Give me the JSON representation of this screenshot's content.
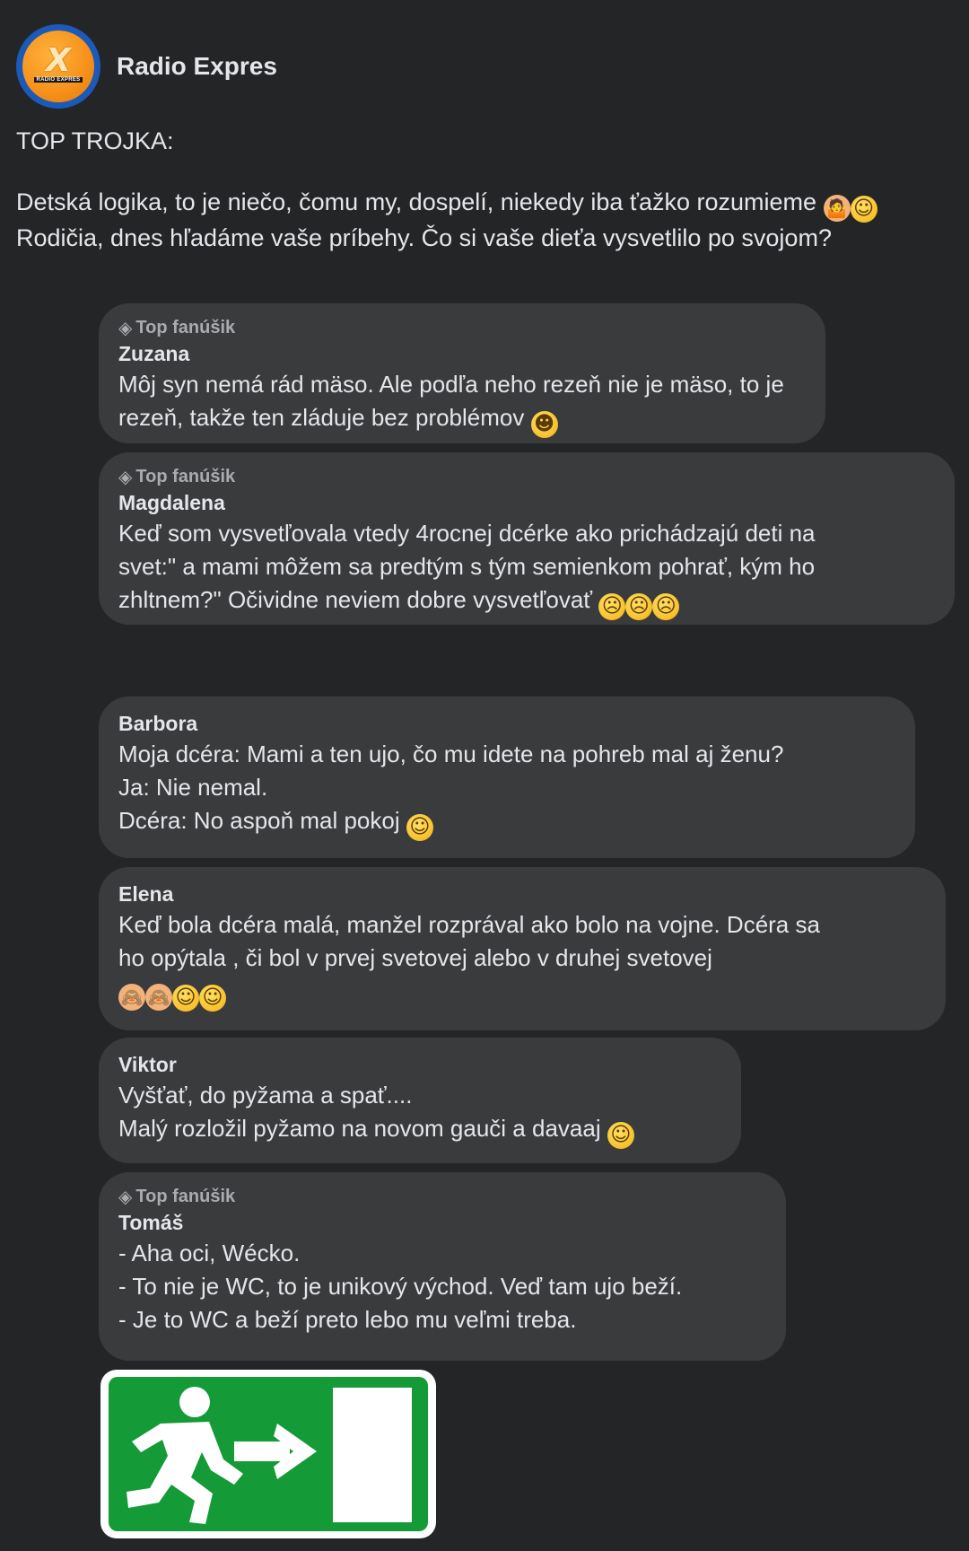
{
  "page": {
    "name": "Radio Expres",
    "avatar_letter": "X",
    "avatar_brand": "RADIO EXPRES"
  },
  "post": {
    "heading": "TOP TROJKA:",
    "line1": "Detská logika, to je niečo, čomu my, dospelí, niekedy iba ťažko rozumieme",
    "line2": "Rodičia, dnes hľadáme vaše príbehy. Čo si vaše dieťa vysvetlilo po svojom?"
  },
  "comments": [
    {
      "badge": "Top fanúšik",
      "author": "Zuzana",
      "lines": [
        "Môj syn nemá rád mäso. Ale podľa neho rezeň nie je mäso, to je",
        "rezeň, takže ten zláduje bez problémov"
      ]
    },
    {
      "badge": "Top fanúšik",
      "author": "Magdalena",
      "lines": [
        "Keď som vysvetľovala vtedy 4rocnej dcérke ako prichádzajú deti na",
        "svet:\" a mami môžem sa predtým s tým semienkom pohrať, kým ho",
        "zhltnem?\"  Očividne neviem dobre vysvetľovať"
      ]
    },
    {
      "author": "Barbora",
      "lines": [
        "Moja dcéra: Mami a ten ujo, čo mu idete na pohreb mal aj ženu?",
        "Ja: Nie nemal.",
        "Dcéra: No aspoň mal pokoj"
      ]
    },
    {
      "author": "Elena",
      "lines": [
        "Keď bola dcéra malá, manžel rozprával ako bolo na vojne. Dcéra sa",
        "ho opýtala , či bol v prvej svetovej alebo v druhej svetovej"
      ]
    },
    {
      "author": "Viktor",
      "lines": [
        "Vyšťať, do pyžama a spať....",
        "Malý rozložil pyžamo na novom gauči a davaaj"
      ]
    },
    {
      "badge": "Top fanúšik",
      "author": "Tomáš",
      "lines": [
        "- Aha oci, Wécko.",
        "- To nie je WC, to je unikový východ. Veď tam ujo beží.",
        "- Je to WC a beží preto lebo mu veľmi treba."
      ]
    }
  ],
  "icons": {
    "badge": "diamond-icon",
    "image": "emergency-exit-sign"
  },
  "colors": {
    "background": "#242526",
    "bubble": "#3a3b3c",
    "text": "#e4e6eb",
    "muted": "#a8abaf",
    "avatar_orange": "#f7931e",
    "avatar_ring": "#1b5ab8",
    "exit_green": "#149a36"
  }
}
